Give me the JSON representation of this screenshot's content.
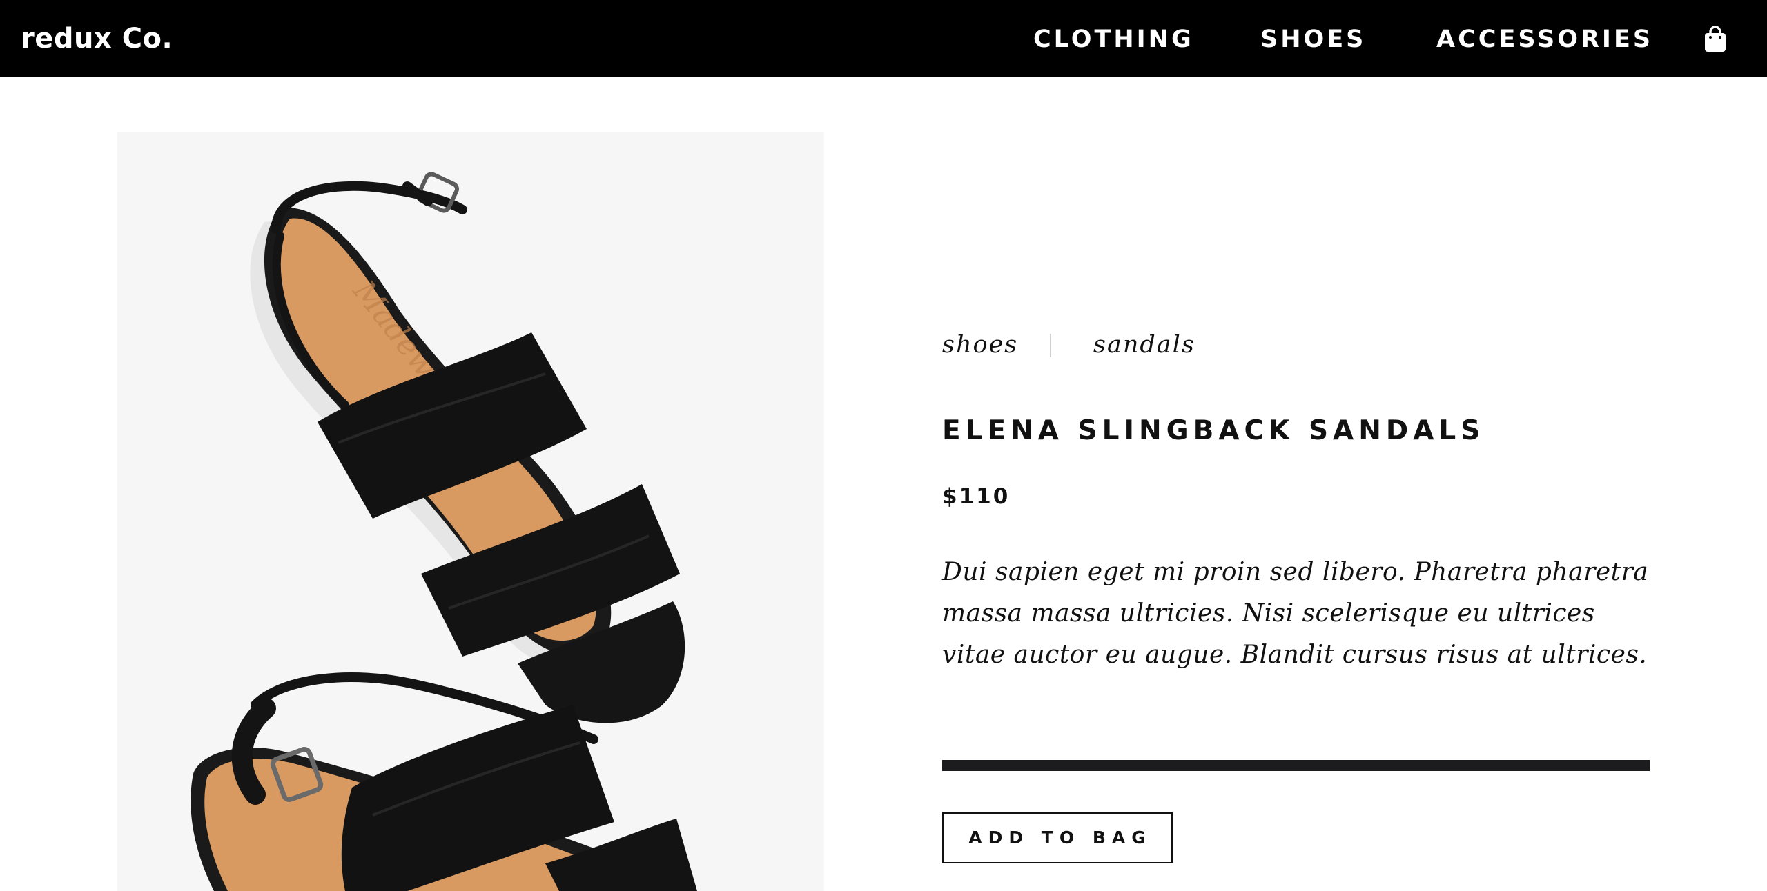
{
  "header": {
    "logo": "redux Co.",
    "nav": [
      {
        "label": "CLOTHING"
      },
      {
        "label": "SHOES"
      },
      {
        "label": "ACCESSORIES"
      }
    ],
    "bag_icon": "shopping-bag-icon"
  },
  "product": {
    "image_subject": "sandals-photo",
    "breadcrumb": [
      "shoes",
      "sandals"
    ],
    "title": "ELENA SLINGBACK SANDALS",
    "price": "$110",
    "description": "Dui sapien eget mi proin sed libero. Pharetra pharetra massa massa ultricies. Nisi scelerisque eu ultrices vitae auctor eu augue. Blandit cursus risus at ultrices.",
    "add_to_bag_label": "ADD TO BAG"
  },
  "colors": {
    "topbar_background": "#000000",
    "image_background": "#f6f6f6",
    "leather_black": "#121212",
    "footbed_tan": "#d99a62",
    "heel_wood": "#c08752",
    "divider": "#1c1c1e"
  }
}
